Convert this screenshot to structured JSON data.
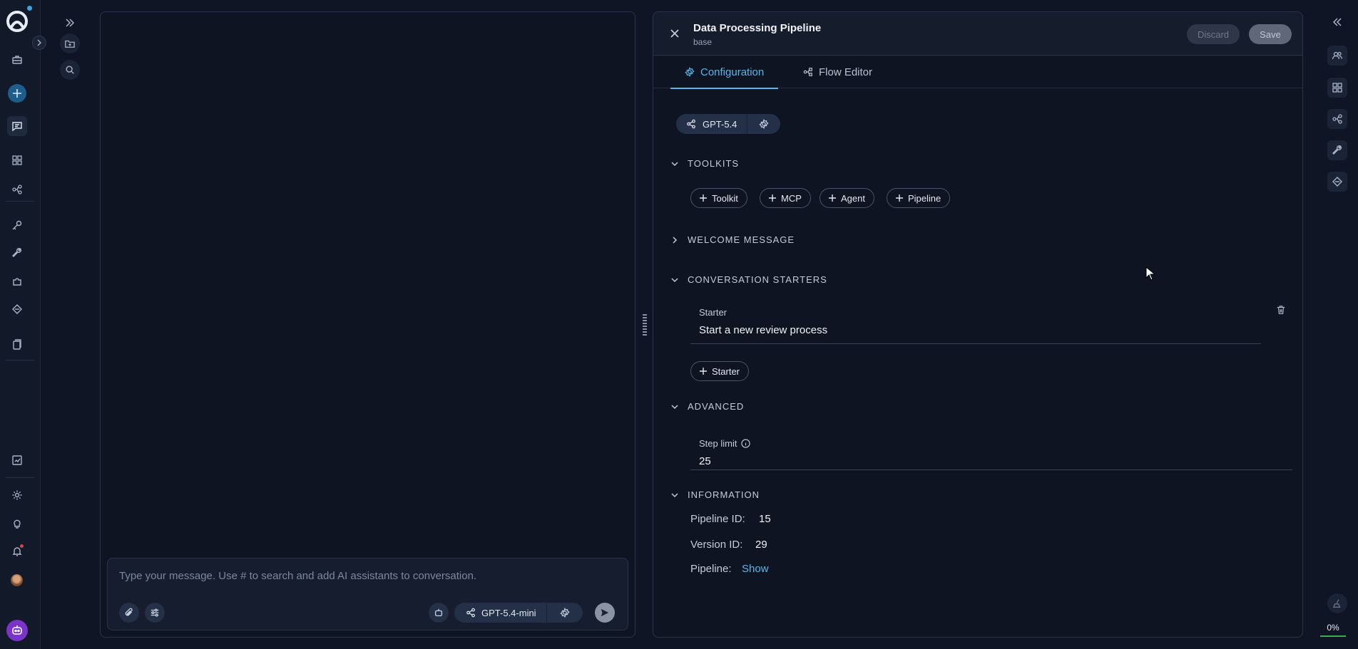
{
  "left_rail": {
    "icons": [
      "logo-icon",
      "expand-icon",
      "briefcase-icon",
      "add-icon",
      "chat-icon",
      "grid-icon",
      "flow-icon",
      "key-icon",
      "wrench-icon",
      "puzzle-icon",
      "layers-icon",
      "clipboard-icon",
      "report-icon",
      "gear-icon",
      "lightbulb-icon",
      "bell-icon",
      "avatar",
      "bot-icon"
    ]
  },
  "secondary": {
    "icons": [
      "double-chevron-right-icon",
      "folder-add-icon",
      "search-icon"
    ]
  },
  "chat": {
    "placeholder": "Type your message. Use # to search and add AI assistants to conversation.",
    "model_label": "GPT-5.4-mini"
  },
  "config": {
    "title": "Data Processing Pipeline",
    "subtitle": "base",
    "discard_label": "Discard",
    "save_label": "Save",
    "tabs": [
      {
        "label": "Configuration",
        "active": true
      },
      {
        "label": "Flow Editor",
        "active": false
      }
    ],
    "llm_label": "GPT-5.4",
    "sections": {
      "toolkits": "TOOLKITS",
      "welcome": "WELCOME MESSAGE",
      "starters": "CONVERSATION STARTERS",
      "advanced": "ADVANCED",
      "information": "INFORMATION"
    },
    "toolkit_chips": [
      "Toolkit",
      "MCP",
      "Agent",
      "Pipeline"
    ],
    "starter": {
      "label": "Starter",
      "value": "Start a new review process",
      "add_label": "Starter"
    },
    "advanced": {
      "step_limit_label": "Step limit",
      "step_limit_value": "25"
    },
    "information": {
      "pipeline_id_label": "Pipeline ID:",
      "pipeline_id_value": "15",
      "version_id_label": "Version ID:",
      "version_id_value": "29",
      "pipeline_label": "Pipeline:",
      "pipeline_link": "Show"
    }
  },
  "right_rail": {
    "icons": [
      "collapse-left-icon",
      "users-icon",
      "grid-icon",
      "flow-icon",
      "wrench-icon",
      "layers-icon",
      "broom-icon"
    ],
    "progress_text": "0%",
    "progress": 0
  },
  "colors": {
    "accent": "#5ab6e8",
    "background": "#0f1524",
    "panel": "#0e1422",
    "progress": "#35b24a"
  }
}
